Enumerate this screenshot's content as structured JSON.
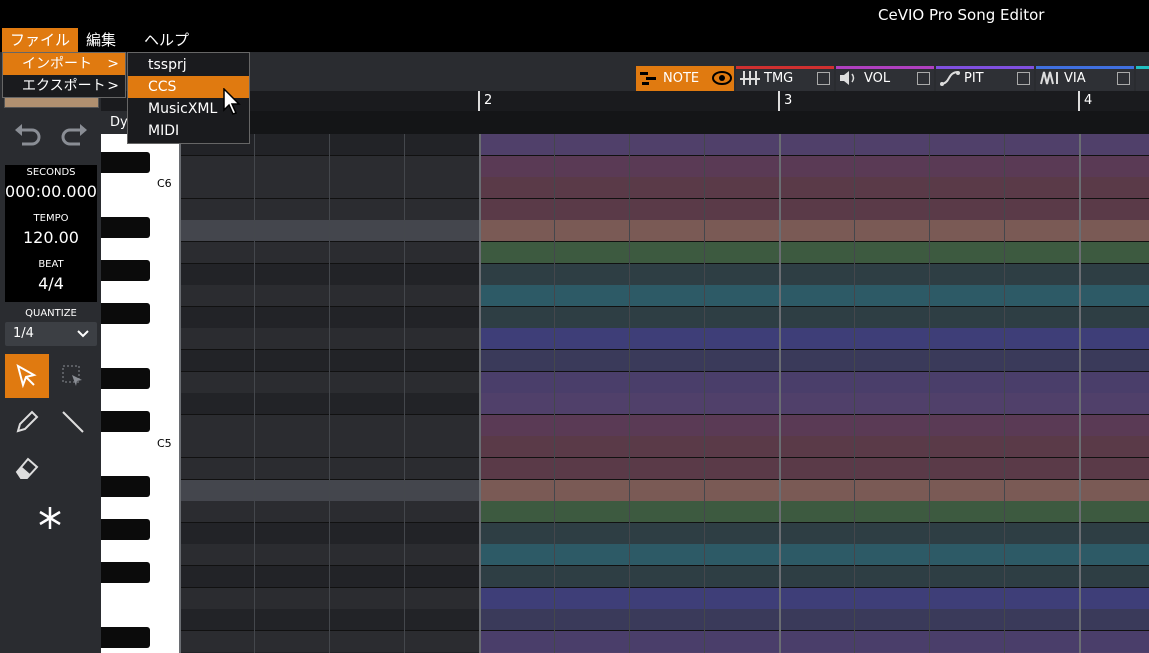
{
  "app": {
    "title": "CeVIO Pro Song Editor"
  },
  "menubar": {
    "file": "ファイル",
    "edit": "編集",
    "help": "ヘルプ"
  },
  "file_menu": {
    "import": "インポート",
    "export": "エクスポート",
    "arrow": ">"
  },
  "import_submenu": [
    "tssprj",
    "CCS",
    "MusicXML",
    "MIDI"
  ],
  "tabs": [
    {
      "label": "NOTE",
      "color": "#e07a10"
    },
    {
      "label": "TMG",
      "color": "#d03030"
    },
    {
      "label": "VOL",
      "color": "#b040c0"
    },
    {
      "label": "PIT",
      "color": "#8050e0"
    },
    {
      "label": "VIA",
      "color": "#4070e0"
    }
  ],
  "ruler": {
    "m2": "2",
    "m3": "3",
    "m4": "4"
  },
  "dynamics_label": "Dy",
  "transport": {
    "seconds_label": "SECONDS",
    "seconds": "000:00.000",
    "tempo_label": "TEMPO",
    "tempo": "120.00",
    "beat_label": "BEAT",
    "beat": "4/4"
  },
  "quantize": {
    "label": "QUANTIZE",
    "value": "1/4"
  },
  "keys": {
    "c6": "C6",
    "c5": "C5"
  },
  "icons": {
    "undo": "undo-icon",
    "redo": "redo-icon",
    "select": "select-arrow-icon",
    "marquee": "marquee-select-icon",
    "pencil": "pencil-icon",
    "line": "line-icon",
    "eraser": "eraser-icon",
    "freeze": "snowflake-icon",
    "eye": "eye-icon",
    "cursor": "mouse-cursor-icon",
    "note_tab": "piano-roll-icon"
  },
  "colors": {
    "accent": "#e07a10"
  }
}
